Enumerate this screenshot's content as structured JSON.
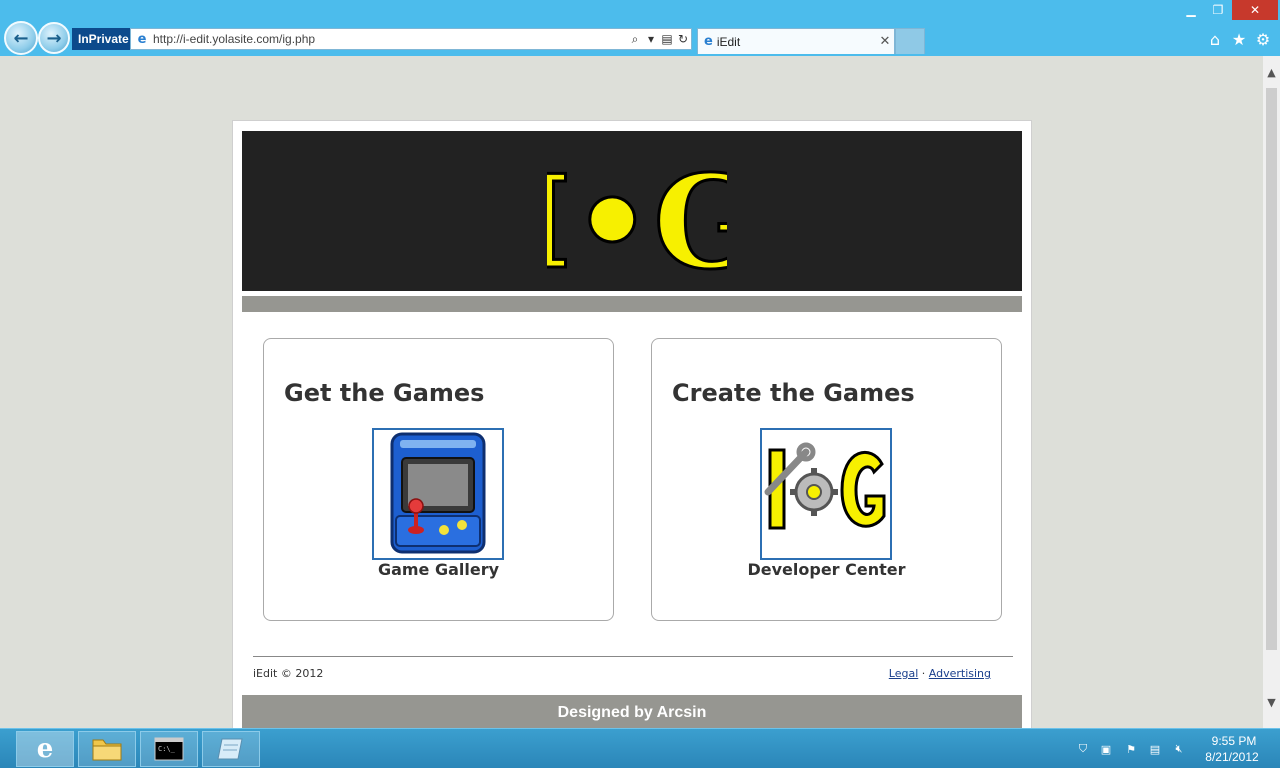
{
  "browser": {
    "inprivate_label": "InPrivate",
    "url": "http://i-edit.yolasite.com/ig.php",
    "tab_title": "iEdit",
    "tab_close": "✕"
  },
  "page": {
    "logo_text": "I•G",
    "cards": [
      {
        "title": "Get the Games",
        "link_label": "Game Gallery"
      },
      {
        "title": "Create the Games",
        "link_label": "Developer Center"
      }
    ],
    "footer": {
      "copyright": "iEdit © 2012",
      "legal": "Legal",
      "separator": "·",
      "advertising": "Advertising"
    },
    "designed_by": "Designed by Arcsin"
  },
  "taskbar": {
    "time": "9:55 PM",
    "date": "8/21/2012"
  },
  "colors": {
    "chrome": "#4cbcec",
    "banner": "#222222",
    "logo_yellow": "#f7f000",
    "strip_gray": "#969691",
    "thumb_border": "#2c6fb3"
  },
  "icons": [
    "back-arrow-icon",
    "forward-arrow-icon",
    "ie-icon",
    "search-icon",
    "refresh-icon",
    "home-icon",
    "star-icon",
    "gear-icon",
    "arcade-cabinet-icon",
    "ig-dev-logo-icon",
    "folder-icon",
    "cmd-icon",
    "notepad-icon"
  ]
}
